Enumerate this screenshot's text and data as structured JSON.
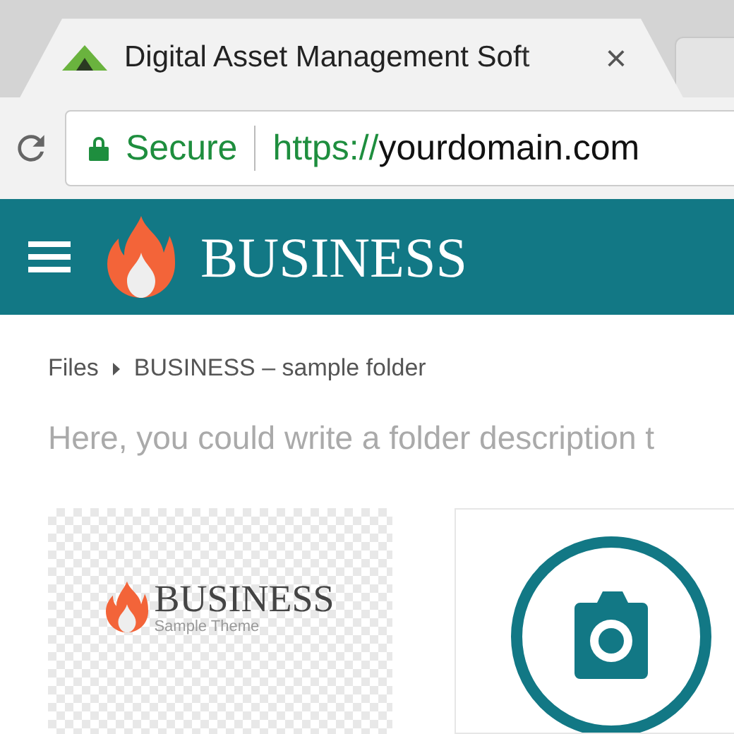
{
  "browser": {
    "tab": {
      "title": "Digital Asset Management Soft",
      "close": "×",
      "selected": true
    },
    "address": {
      "security": "Secure",
      "scheme": "https://",
      "host": "yourdomain.com"
    }
  },
  "header": {
    "title": "BUSINESS"
  },
  "breadcrumb": [
    "Files",
    "BUSINESS – sample folder"
  ],
  "description": "Here, you could write a folder description t",
  "files": [
    {
      "kind": "image",
      "logo_title": "BUSINESS",
      "logo_subtitle": "Sample Theme"
    },
    {
      "kind": "camera"
    }
  ]
}
